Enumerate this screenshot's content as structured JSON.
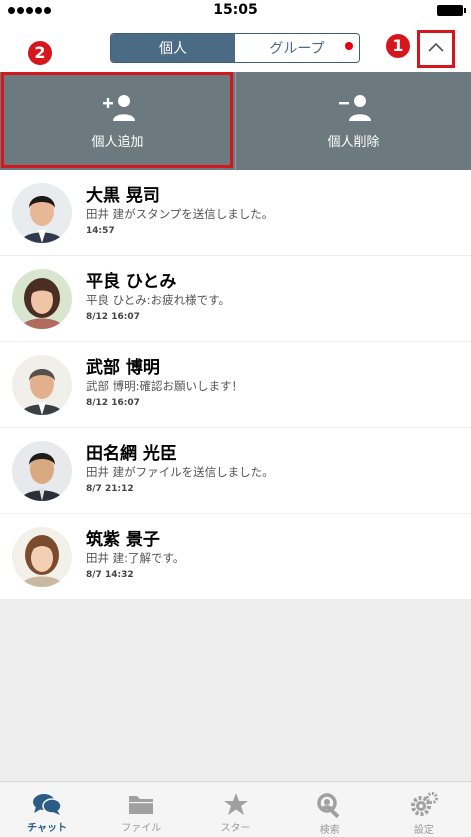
{
  "status_bar": {
    "time": "15:05"
  },
  "header": {
    "segments": [
      {
        "label": "個人",
        "active": true
      },
      {
        "label": "グループ",
        "active": false,
        "has_badge": true
      }
    ],
    "marker_1": "1",
    "marker_2": "2"
  },
  "actions": [
    {
      "label": "個人追加",
      "icon": "add-person-icon"
    },
    {
      "label": "個人削除",
      "icon": "remove-person-icon"
    }
  ],
  "chats": [
    {
      "name": "大黒 晃司",
      "message": "田井 建がスタンプを送信しました。",
      "time": "14:57"
    },
    {
      "name": "平良 ひとみ",
      "message": "平良 ひとみ:お疲れ様です。",
      "time": "8/12 16:07"
    },
    {
      "name": "武部 博明",
      "message": "武部 博明:確認お願いします！",
      "time": "8/12 16:07"
    },
    {
      "name": "田名網 光臣",
      "message": "田井 建がファイルを送信しました。",
      "time": "8/7 21:12"
    },
    {
      "name": "筑紫 景子",
      "message": "田井 建:了解です。",
      "time": "8/7 14:32"
    }
  ],
  "tabs": [
    {
      "label": "チャット",
      "icon": "chat-bubbles-icon",
      "active": true
    },
    {
      "label": "ファイル",
      "icon": "folder-icon",
      "active": false
    },
    {
      "label": "スター",
      "icon": "star-icon",
      "active": false
    },
    {
      "label": "検索",
      "icon": "search-icon",
      "active": false
    },
    {
      "label": "設定",
      "icon": "gear-icon",
      "active": false
    }
  ],
  "colors": {
    "accent": "#4b6b84",
    "highlight": "#d6161d",
    "action_bar": "#6c7a80"
  }
}
